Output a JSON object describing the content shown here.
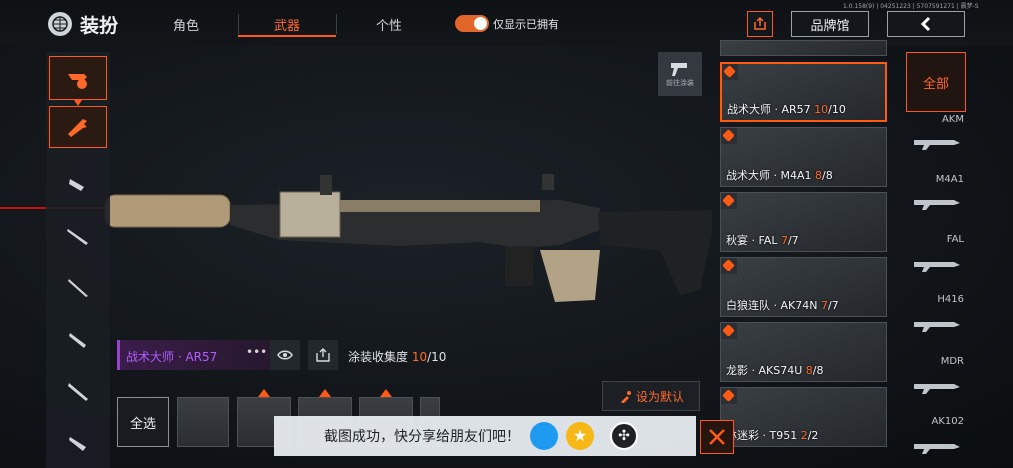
{
  "version_text": "1.0.158(9) | 04251223 | 5707591271 | 晨梦-S",
  "header": {
    "title": "装扮",
    "tabs": [
      {
        "label": "角色",
        "active": false
      },
      {
        "label": "武器",
        "active": true
      },
      {
        "label": "个性",
        "active": false
      }
    ],
    "toggle": {
      "label": "仅显示已拥有",
      "on": true
    },
    "brand_label": "品牌馆"
  },
  "goto_label": "前往涂装",
  "skins": [
    {
      "name": "战术大师 · AR57 ",
      "count": "10",
      "total": "/10",
      "selected": true
    },
    {
      "name": "战术大师 · M4A1 ",
      "count": "8",
      "total": "/8",
      "selected": false
    },
    {
      "name": "秋宴 · FAL ",
      "count": "7",
      "total": "/7",
      "selected": false
    },
    {
      "name": "白狼连队 · AK74N ",
      "count": "7",
      "total": "/7",
      "selected": false
    },
    {
      "name": "龙影 · AKS74U ",
      "count": "8",
      "total": "/8",
      "selected": false
    },
    {
      "name": "林迷彩 · T951 ",
      "count": "2",
      "total": "/2",
      "selected": false
    }
  ],
  "weapon_filter": {
    "all_label": "全部",
    "types": [
      "AKM",
      "M4A1",
      "FAL",
      "H416",
      "MDR",
      "AK102"
    ]
  },
  "current_skin": {
    "name": "战术大师 · AR57",
    "collect_label": "涂装收集度 ",
    "collect_count": "10",
    "collect_total": "/10"
  },
  "select_all_label": "全选",
  "set_default_label": "设为默认",
  "toast": {
    "message": "截图成功，快分享给朋友们吧！"
  },
  "colors": {
    "accent": "#ff5a14",
    "purple": "#b25cff"
  },
  "icons": [
    "globe-icon",
    "share-icon",
    "back-arrow-icon",
    "eye-icon",
    "more-icon",
    "qq-icon",
    "qzone-icon",
    "wechat-icon",
    "close-icon",
    "spray-icon"
  ]
}
